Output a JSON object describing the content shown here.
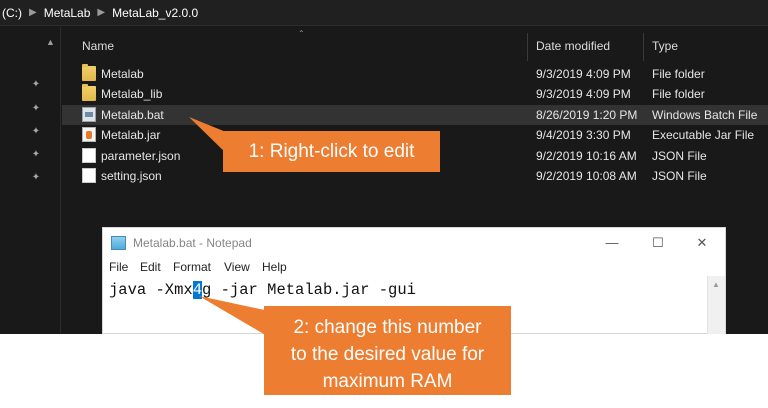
{
  "explorer": {
    "breadcrumb": [
      "(C:)",
      "MetaLab",
      "MetaLab_v2.0.0"
    ],
    "columns": {
      "name": "Name",
      "date": "Date modified",
      "type": "Type"
    },
    "files": [
      {
        "name": "Metalab",
        "date": "9/3/2019 4:09 PM",
        "type": "File folder",
        "icon": "folder-icon"
      },
      {
        "name": "Metalab_lib",
        "date": "9/3/2019 4:09 PM",
        "type": "File folder",
        "icon": "folder-icon"
      },
      {
        "name": "Metalab.bat",
        "date": "8/26/2019 1:20 PM",
        "type": "Windows Batch File",
        "icon": "batch-file-icon",
        "selected": true
      },
      {
        "name": "Metalab.jar",
        "date": "9/4/2019 3:30 PM",
        "type": "Executable Jar File",
        "icon": "jar-file-icon"
      },
      {
        "name": "parameter.json",
        "date": "9/2/2019 10:16 AM",
        "type": "JSON File",
        "icon": "json-file-icon"
      },
      {
        "name": "setting.json",
        "date": "9/2/2019 10:08 AM",
        "type": "JSON File",
        "icon": "json-file-icon"
      }
    ],
    "selected_color": "#333333"
  },
  "notepad": {
    "title": "Metalab.bat - Notepad",
    "menu": [
      "File",
      "Edit",
      "Format",
      "View",
      "Help"
    ],
    "content": {
      "before": "java -Xmx",
      "selected": "4",
      "after": "g -jar Metalab.jar -gui"
    },
    "selection_color": "#0078d7"
  },
  "callouts": {
    "first": "1: Right-click to edit",
    "second": [
      "2: change this number",
      "to the desired value for",
      "maximum RAM"
    ],
    "color": "#ed7d31"
  }
}
